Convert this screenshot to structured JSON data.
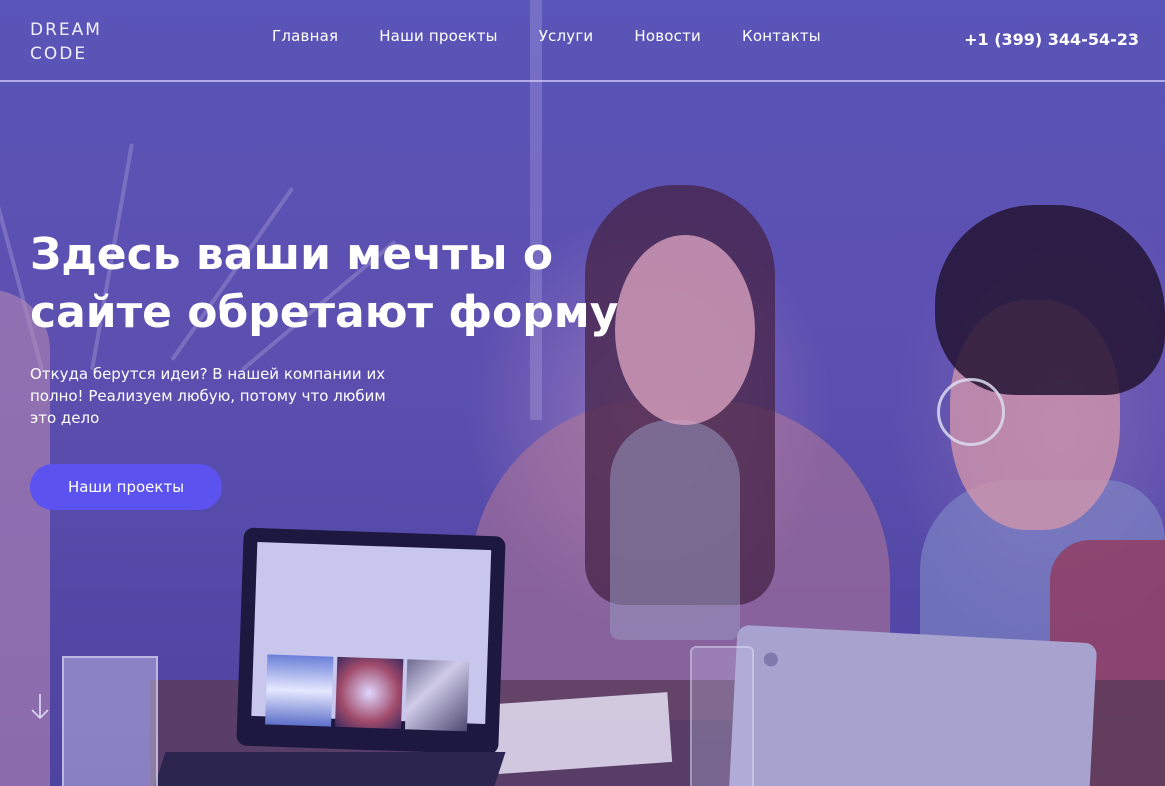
{
  "header": {
    "logo": {
      "line1": "DREAM",
      "line2": "CODE"
    },
    "nav": [
      {
        "label": "Главная"
      },
      {
        "label": "Наши проекты"
      },
      {
        "label": "Услуги"
      },
      {
        "label": "Новости"
      },
      {
        "label": "Контакты"
      }
    ],
    "phone": "+1 (399) 344-54-23"
  },
  "hero": {
    "title": "Здесь ваши мечты о сайте обретают форму",
    "text": "Откуда берутся идеи? В нашей компании их полно! Реализуем любую, потому что любим это дело",
    "cta_label": "Наши проекты",
    "scroll_icon": "arrow-down-icon",
    "background_image": "photo-people-laughing-at-laptops"
  },
  "colors": {
    "overlay": "#5a55b8",
    "button": "#5b52f0",
    "text": "#ffffff"
  }
}
